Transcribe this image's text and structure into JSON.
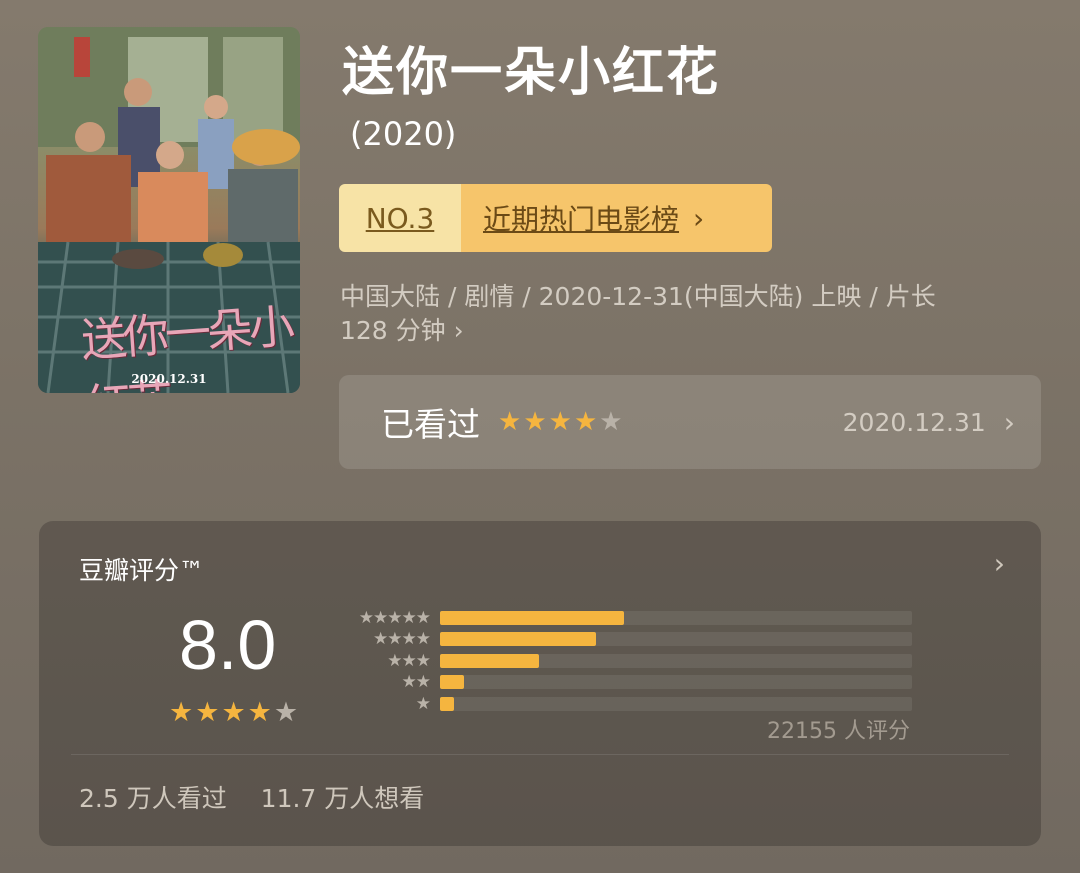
{
  "movie": {
    "title": "送你一朵小红花",
    "year": "(2020)",
    "poster": {
      "date": "2020.12.31",
      "title_art": "送你一朵小红花"
    }
  },
  "ranking": {
    "number": "NO.3",
    "list_name": "近期热门电影榜",
    "chevron": "›"
  },
  "meta": {
    "line1": "中国大陆 / 剧情 / 2020-12-31(中国大陆) 上映 / 片长",
    "line2": "128 分钟",
    "more_chevron": "›"
  },
  "my_rating": {
    "status": "已看过",
    "stars": 4,
    "max_stars": 5,
    "date": "2020.12.31",
    "chevron": "›"
  },
  "douban_rating": {
    "title": "豆瓣评分™",
    "chevron": "›",
    "score": "8.0",
    "stars": 4,
    "max_stars": 5,
    "distribution": [
      {
        "stars": 5,
        "fraction": 0.39
      },
      {
        "stars": 4,
        "fraction": 0.33
      },
      {
        "stars": 3,
        "fraction": 0.21
      },
      {
        "stars": 2,
        "fraction": 0.05
      },
      {
        "stars": 1,
        "fraction": 0.03
      }
    ],
    "rating_count": "22155 人评分",
    "watched": "2.5 万人看过",
    "want_to_watch": "11.7 万人想看"
  },
  "colors": {
    "star_on": "#f5b53f",
    "badge_left": "#f7e3a6",
    "badge_right": "#f6c56b"
  },
  "icons": {
    "star": "star-icon",
    "chevron": "chevron-right-icon"
  }
}
